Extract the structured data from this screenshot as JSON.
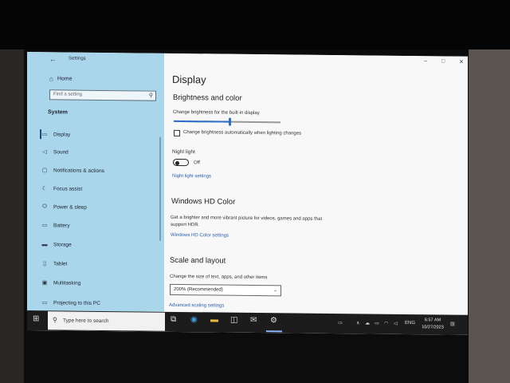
{
  "window": {
    "title": "Settings",
    "controls": [
      "–",
      "□",
      "✕"
    ]
  },
  "sidebar": {
    "home_label": "Home",
    "search_placeholder": "Find a setting",
    "section_label": "System",
    "items": [
      {
        "label": "Display",
        "icon": "monitor-icon",
        "glyph": "▭",
        "active": true
      },
      {
        "label": "Sound",
        "icon": "speaker-icon",
        "glyph": "◁"
      },
      {
        "label": "Notifications & actions",
        "icon": "notifications-icon",
        "glyph": "▢"
      },
      {
        "label": "Focus assist",
        "icon": "moon-icon",
        "glyph": "☾"
      },
      {
        "label": "Power & sleep",
        "icon": "power-icon",
        "glyph": "⏻"
      },
      {
        "label": "Battery",
        "icon": "battery-icon",
        "glyph": "▭"
      },
      {
        "label": "Storage",
        "icon": "storage-icon",
        "glyph": "▬"
      },
      {
        "label": "Tablet",
        "icon": "tablet-icon",
        "glyph": "▯"
      },
      {
        "label": "Multitasking",
        "icon": "multitasking-icon",
        "glyph": "▣"
      },
      {
        "label": "Projecting to this PC",
        "icon": "projecting-icon",
        "glyph": "▭"
      }
    ]
  },
  "content": {
    "title": "Display",
    "brightness": {
      "heading": "Brightness and color",
      "slider_label": "Change brightness for the built-in display",
      "level": 0.52,
      "auto_label": "Change brightness automatically when lighting changes",
      "auto_checked": false
    },
    "night_light": {
      "label": "Night light",
      "state": "Off",
      "settings_link": "Night light settings"
    },
    "hd_color": {
      "heading": "Windows HD Color",
      "description_line1": "Get a brighter and more vibrant picture for videos, games and apps that",
      "description_line2": "support HDR.",
      "settings_link": "Windows HD Color settings"
    },
    "scale": {
      "heading": "Scale and layout",
      "label": "Change the size of text, apps, and other items",
      "selected": "200% (Recommended)",
      "advanced_link": "Advanced scaling settings"
    }
  },
  "taskbar": {
    "search_placeholder": "Type here to search",
    "language": "ENG",
    "time": "6:57 AM",
    "date": "10/27/2023"
  },
  "colors": {
    "sidebar_bg": "#a9d6ea",
    "accent": "#2a6fc9",
    "link": "#2a5fb0",
    "taskbar": "#1c1c1c"
  }
}
